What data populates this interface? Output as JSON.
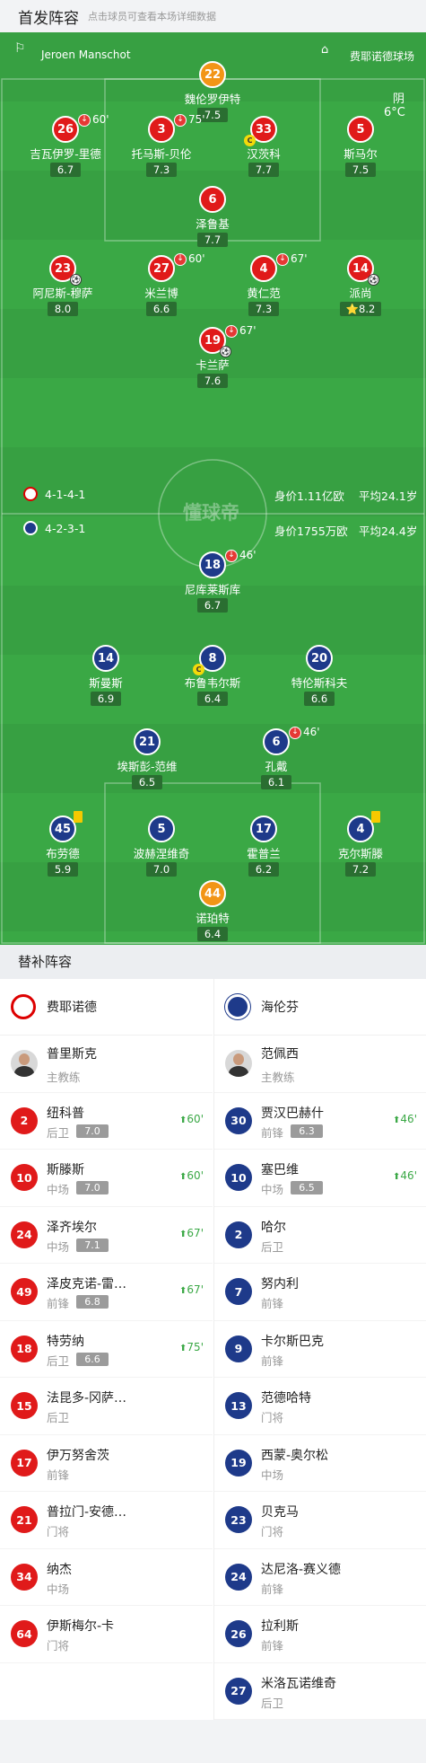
{
  "header": {
    "title": "首发阵容",
    "subtitle": "点击球员可查看本场详细数据"
  },
  "pitch": {
    "referee": "Jeroen Manschot",
    "stadium": "费耶诺德球场",
    "weather": "阴",
    "temperature": "6°C",
    "watermark": "懂球帝",
    "home": {
      "formation": "4-1-4-1",
      "value": "身价1.11亿欧",
      "age": "平均24.1岁"
    },
    "away": {
      "formation": "4-2-3-1",
      "value": "身价1755万欧",
      "age": "平均24.4岁"
    }
  },
  "players": [
    {
      "num": "22",
      "name": "魏伦罗伊特",
      "rating": "7.5",
      "side": "gk"
    },
    {
      "num": "26",
      "name": "吉瓦伊罗-里德",
      "rating": "6.7",
      "side": "home",
      "sub": "60'"
    },
    {
      "num": "3",
      "name": "托马斯-贝伦",
      "rating": "7.3",
      "side": "home",
      "sub": "75'"
    },
    {
      "num": "33",
      "name": "汉茨科",
      "rating": "7.7",
      "side": "home",
      "captain": "C"
    },
    {
      "num": "5",
      "name": "斯马尔",
      "rating": "7.5",
      "side": "home"
    },
    {
      "num": "6",
      "name": "泽鲁基",
      "rating": "7.7",
      "side": "home"
    },
    {
      "num": "23",
      "name": "阿尼斯-穆萨",
      "rating": "8.0",
      "side": "home",
      "goal": "⚽"
    },
    {
      "num": "27",
      "name": "米兰博",
      "rating": "6.6",
      "side": "home",
      "sub": "60'"
    },
    {
      "num": "4",
      "name": "黄仁范",
      "rating": "7.3",
      "side": "home",
      "sub": "67'"
    },
    {
      "num": "14",
      "name": "派尚",
      "rating": "8.2",
      "side": "home",
      "goal": "⚽",
      "star": "⭐"
    },
    {
      "num": "19",
      "name": "卡兰萨",
      "rating": "7.6",
      "side": "home",
      "sub": "67'",
      "goal": "⚽"
    },
    {
      "num": "18",
      "name": "尼库莱斯库",
      "rating": "6.7",
      "side": "away",
      "sub": "46'"
    },
    {
      "num": "14",
      "name": "斯曼斯",
      "rating": "6.9",
      "side": "away"
    },
    {
      "num": "8",
      "name": "布鲁韦尔斯",
      "rating": "6.4",
      "side": "away",
      "captain": "C"
    },
    {
      "num": "20",
      "name": "特伦斯科夫",
      "rating": "6.6",
      "side": "away"
    },
    {
      "num": "21",
      "name": "埃斯彭-范维",
      "rating": "6.5",
      "side": "away"
    },
    {
      "num": "6",
      "name": "孔戴",
      "rating": "6.1",
      "side": "away",
      "sub": "46'"
    },
    {
      "num": "45",
      "name": "布劳德",
      "rating": "5.9",
      "side": "away",
      "card": "yellow"
    },
    {
      "num": "5",
      "name": "波赫涅维奇",
      "rating": "7.0",
      "side": "away"
    },
    {
      "num": "17",
      "name": "霍普兰",
      "rating": "6.2",
      "side": "away"
    },
    {
      "num": "4",
      "name": "克尔斯滕",
      "rating": "7.2",
      "side": "away",
      "card": "yellow"
    },
    {
      "num": "44",
      "name": "诺珀特",
      "rating": "6.4",
      "side": "gk"
    }
  ],
  "subs": {
    "title": "替补阵容",
    "home": {
      "team": "费耶诺德",
      "coach": {
        "name": "普里斯克",
        "role": "主教练"
      },
      "players": [
        {
          "num": "2",
          "name": "纽科普",
          "pos": "后卫",
          "rating": "7.0",
          "time": "60'"
        },
        {
          "num": "10",
          "name": "斯滕斯",
          "pos": "中场",
          "rating": "7.0",
          "time": "60'"
        },
        {
          "num": "24",
          "name": "泽齐埃尔",
          "pos": "中场",
          "rating": "7.1",
          "time": "67'"
        },
        {
          "num": "49",
          "name": "泽皮克诺-雷…",
          "pos": "前锋",
          "rating": "6.8",
          "time": "67'"
        },
        {
          "num": "18",
          "name": "特劳纳",
          "pos": "后卫",
          "rating": "6.6",
          "time": "75'"
        },
        {
          "num": "15",
          "name": "法昆多-冈萨…",
          "pos": "后卫"
        },
        {
          "num": "17",
          "name": "伊万努舍茨",
          "pos": "前锋"
        },
        {
          "num": "21",
          "name": "普拉门-安德…",
          "pos": "门将"
        },
        {
          "num": "34",
          "name": "纳杰",
          "pos": "中场"
        },
        {
          "num": "64",
          "name": "伊斯梅尔-卡",
          "pos": "门将"
        }
      ]
    },
    "away": {
      "team": "海伦芬",
      "coach": {
        "name": "范佩西",
        "role": "主教练"
      },
      "players": [
        {
          "num": "30",
          "name": "贾汉巴赫什",
          "pos": "前锋",
          "rating": "6.3",
          "time": "46'"
        },
        {
          "num": "10",
          "name": "塞巴维",
          "pos": "中场",
          "rating": "6.5",
          "time": "46'"
        },
        {
          "num": "2",
          "name": "哈尔",
          "pos": "后卫"
        },
        {
          "num": "7",
          "name": "努内利",
          "pos": "前锋"
        },
        {
          "num": "9",
          "name": "卡尔斯巴克",
          "pos": "前锋"
        },
        {
          "num": "13",
          "name": "范德哈特",
          "pos": "门将"
        },
        {
          "num": "19",
          "name": "西蒙-奥尔松",
          "pos": "中场"
        },
        {
          "num": "23",
          "name": "贝克马",
          "pos": "门将"
        },
        {
          "num": "24",
          "name": "达尼洛-赛义德",
          "pos": "前锋"
        },
        {
          "num": "26",
          "name": "拉利斯",
          "pos": "前锋"
        },
        {
          "num": "27",
          "name": "米洛瓦诺维奇",
          "pos": "后卫"
        }
      ]
    }
  }
}
